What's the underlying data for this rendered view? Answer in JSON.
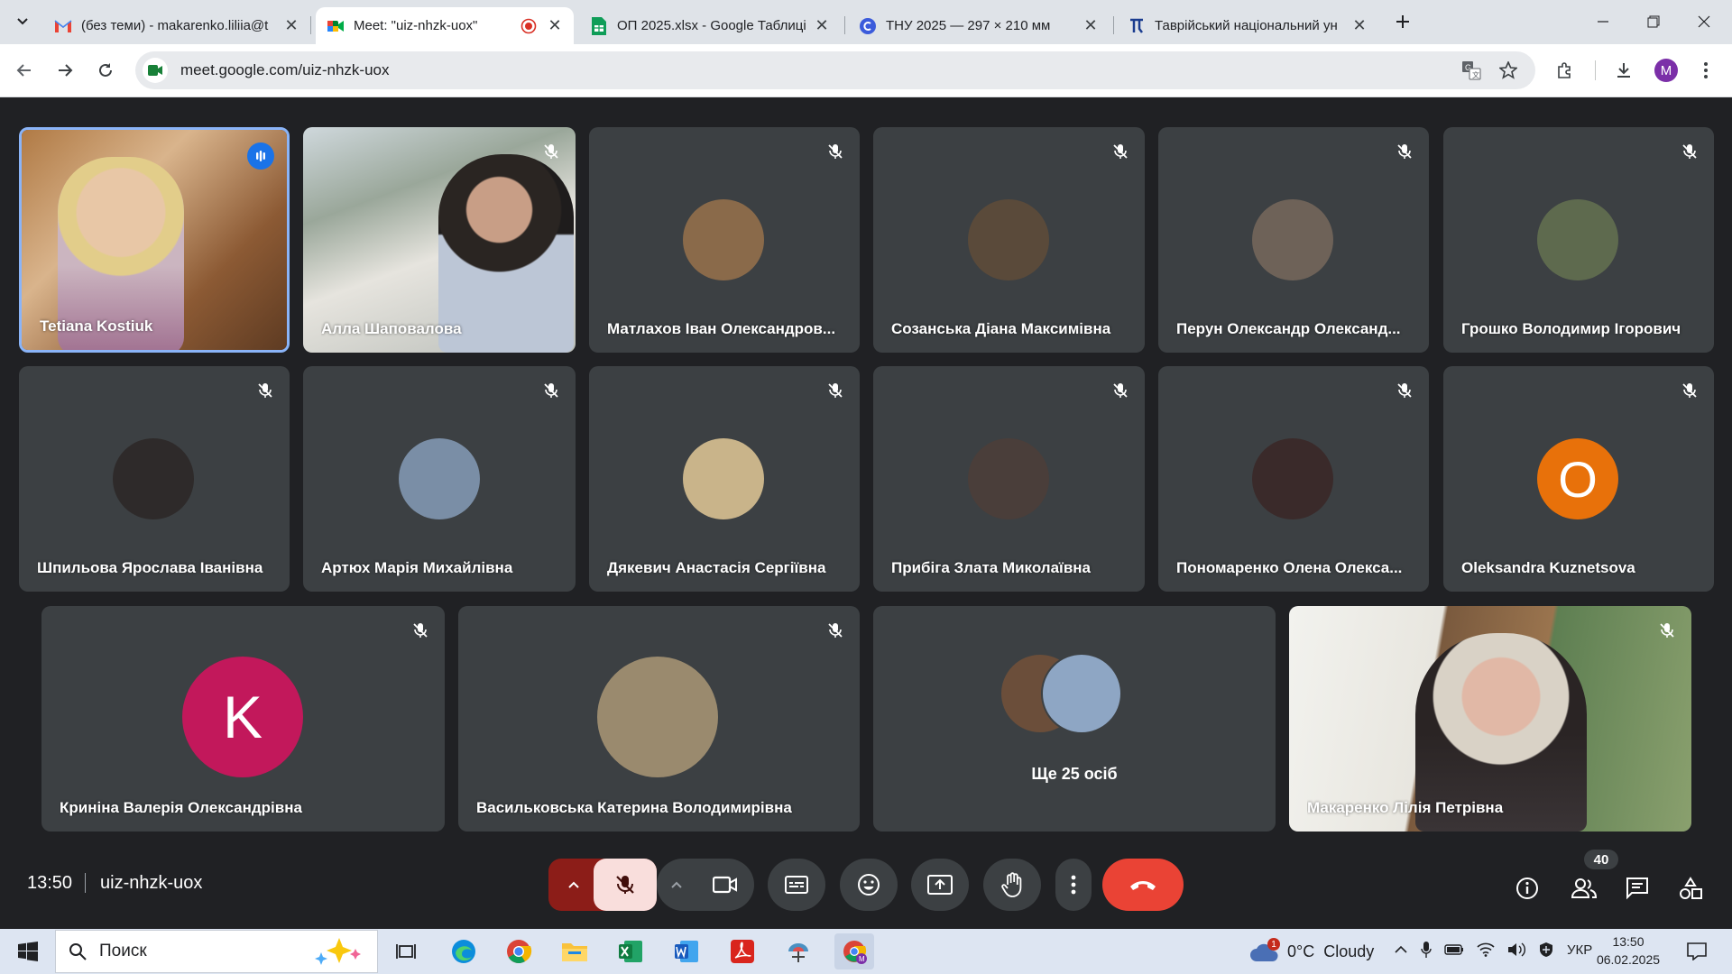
{
  "browser": {
    "tabs": [
      {
        "title": "(без теми) - makarenko.liliia@t",
        "icon": "gmail-icon"
      },
      {
        "title": "Meet: \"uiz-nhzk-uox\"",
        "icon": "meet-icon",
        "active": true
      },
      {
        "title": "ОП 2025.xlsx - Google Таблиці",
        "icon": "sheets-icon"
      },
      {
        "title": "ТНУ 2025 — 297 × 210 мм",
        "icon": "canva-icon"
      },
      {
        "title": "Таврійський національний ун",
        "icon": "university-icon"
      }
    ],
    "url": "meet.google.com/uiz-nhzk-uox",
    "profile_initial": "M"
  },
  "participants": {
    "row1": [
      {
        "name": "Tetiana Kostiuk",
        "type": "video",
        "speaking": true
      },
      {
        "name": "Алла Шаповалова",
        "type": "video"
      },
      {
        "name": "Матлахов Іван Олександров...",
        "type": "photo",
        "color": "#8a6a4a"
      },
      {
        "name": "Созанська Діана Максимівна",
        "type": "photo",
        "color": "#5a4a3a"
      },
      {
        "name": "Перун Олександр Олександ...",
        "type": "photo",
        "color": "#6e6258"
      },
      {
        "name": "Грошко Володимир Ігорович",
        "type": "photo",
        "color": "#5e6a4e"
      }
    ],
    "row2": [
      {
        "name": "Шпильова Ярослава Іванівна",
        "type": "photo",
        "color": "#2e2a2a"
      },
      {
        "name": "Артюх Марія Михайлівна",
        "type": "photo",
        "color": "#7a8ea6"
      },
      {
        "name": "Дякевич Анастасія Сергіївна",
        "type": "photo",
        "color": "#c9b48a"
      },
      {
        "name": "Прибіга Злата Миколаївна",
        "type": "photo",
        "color": "#4a3e3a"
      },
      {
        "name": "Пономаренко Олена Олекса...",
        "type": "photo",
        "color": "#3a2a2a"
      },
      {
        "name": "Oleksandra Kuznetsova",
        "type": "letter",
        "letter": "O",
        "color": "#e8710a"
      }
    ],
    "row3": [
      {
        "name": "Криніна Валерія Олександрівна",
        "type": "letter",
        "letter": "K",
        "color": "#c2185b"
      },
      {
        "name": "Васильковська Катерина Володимирівна",
        "type": "photo",
        "color": "#9a8a6e"
      },
      {
        "name": "Ще 25 осіб",
        "type": "more"
      },
      {
        "name": "Макаренко Лілія Петрівна",
        "type": "video"
      }
    ]
  },
  "meeting": {
    "time": "13:50",
    "code": "uiz-nhzk-uox",
    "participant_count": "40"
  },
  "taskbar": {
    "search_placeholder": "Поиск",
    "weather": "0°C  Cloudy",
    "weather_badge": "1",
    "language": "УКР",
    "time": "13:50",
    "date": "06.02.2025"
  }
}
